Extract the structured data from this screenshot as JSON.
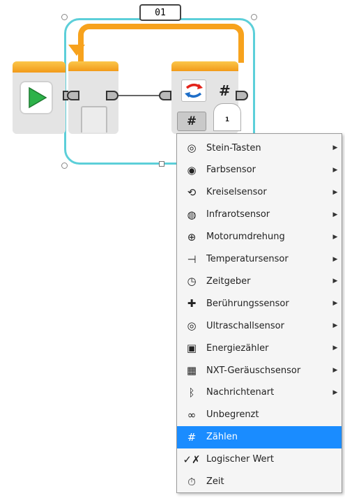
{
  "loop": {
    "label": "01",
    "count_badge": "1",
    "mode_icon": "hash-icon",
    "mode_symbol": "#"
  },
  "context_menu": {
    "items": [
      {
        "label": "Stein-Tasten",
        "icon": "brick-buttons-icon",
        "glyph": "◎",
        "submenu": true
      },
      {
        "label": "Farbsensor",
        "icon": "color-sensor-icon",
        "glyph": "◉",
        "submenu": true
      },
      {
        "label": "Kreiselsensor",
        "icon": "gyro-sensor-icon",
        "glyph": "⟲",
        "submenu": true
      },
      {
        "label": "Infrarotsensor",
        "icon": "infrared-sensor-icon",
        "glyph": "◍",
        "submenu": true
      },
      {
        "label": "Motorumdrehung",
        "icon": "motor-rotation-icon",
        "glyph": "⊕",
        "submenu": true
      },
      {
        "label": "Temperatursensor",
        "icon": "temperature-sensor-icon",
        "glyph": "⊣",
        "submenu": true
      },
      {
        "label": "Zeitgeber",
        "icon": "timer-icon",
        "glyph": "◷",
        "submenu": true
      },
      {
        "label": "Berührungssensor",
        "icon": "touch-sensor-icon",
        "glyph": "✚",
        "submenu": true
      },
      {
        "label": "Ultraschallsensor",
        "icon": "ultrasonic-sensor-icon",
        "glyph": "◎",
        "submenu": true
      },
      {
        "label": "Energiezähler",
        "icon": "energy-meter-icon",
        "glyph": "▣",
        "submenu": true
      },
      {
        "label": "NXT-Geräuschsensor",
        "icon": "sound-sensor-icon",
        "glyph": "▦",
        "submenu": true
      },
      {
        "label": "Nachrichtenart",
        "icon": "bluetooth-icon",
        "glyph": "ᛒ",
        "submenu": true
      },
      {
        "label": "Unbegrenzt",
        "icon": "infinity-icon",
        "glyph": "∞",
        "submenu": false
      },
      {
        "label": "Zählen",
        "icon": "hash-icon",
        "glyph": "#",
        "submenu": false,
        "selected": true
      },
      {
        "label": "Logischer Wert",
        "icon": "logic-value-icon",
        "glyph": "✓✗",
        "submenu": false
      },
      {
        "label": "Zeit",
        "icon": "stopwatch-icon",
        "glyph": "⏱",
        "submenu": false
      }
    ],
    "arrow_glyph": "▶"
  },
  "colors": {
    "loop_frame": "#5ccfd9",
    "loop_bar": "#f7a21d",
    "start_play": "#2db24a",
    "mode_icon_red": "#e2231a",
    "mode_icon_blue": "#1e6ec8",
    "selection": "#1a8cff"
  }
}
